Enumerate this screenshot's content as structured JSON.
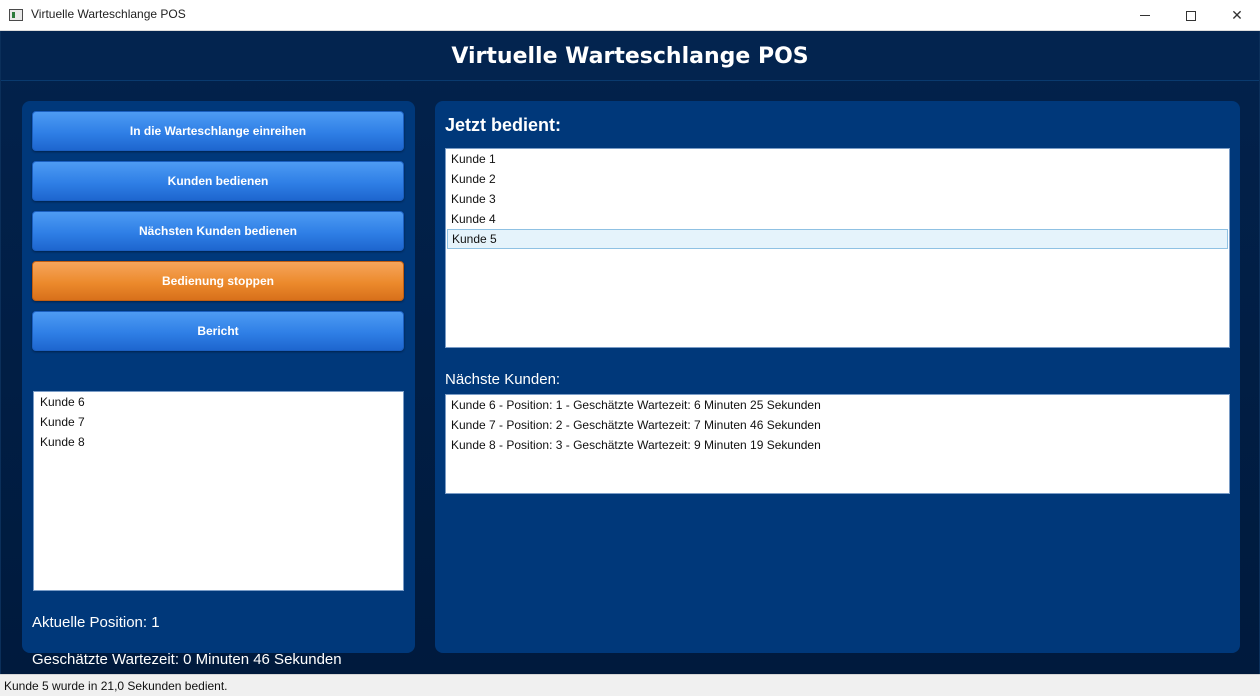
{
  "window": {
    "title": "Virtuelle Warteschlange POS",
    "minimize_glyph": "",
    "maximize_glyph": "",
    "close_glyph": "✕"
  },
  "header": {
    "title": "Virtuelle Warteschlange POS"
  },
  "left": {
    "buttons": [
      {
        "label": "In die Warteschlange einreihen"
      },
      {
        "label": "Kunden bedienen"
      },
      {
        "label": "Nächsten Kunden bedienen"
      },
      {
        "label": "Bedienung stoppen"
      },
      {
        "label": "Bericht"
      }
    ],
    "queue": [
      "Kunde 6",
      "Kunde 7",
      "Kunde 8"
    ],
    "position_text": "Aktuelle Position: 1",
    "wait_text": "Geschätzte Wartezeit: 0 Minuten 46 Sekunden"
  },
  "right": {
    "served_title": "Jetzt bedient:",
    "served": [
      "Kunde 1",
      "Kunde 2",
      "Kunde 3",
      "Kunde 4",
      "Kunde 5"
    ],
    "served_selected_index": 4,
    "next_title": "Nächste Kunden:",
    "next": [
      "Kunde 6 - Position: 1 - Geschätzte Wartezeit: 6 Minuten 25 Sekunden",
      "Kunde 7 - Position: 2 - Geschätzte Wartezeit: 7 Minuten 46 Sekunden",
      "Kunde 8 - Position: 3 - Geschätzte Wartezeit: 9 Minuten 19 Sekunden"
    ]
  },
  "status": {
    "text": "Kunde 5 wurde in 21,0 Sekunden bedient."
  },
  "colors": {
    "blue_button": "#2f7fe6",
    "orange_button": "#ec8a2c",
    "panel": "#00387a",
    "background": "#02224c"
  }
}
